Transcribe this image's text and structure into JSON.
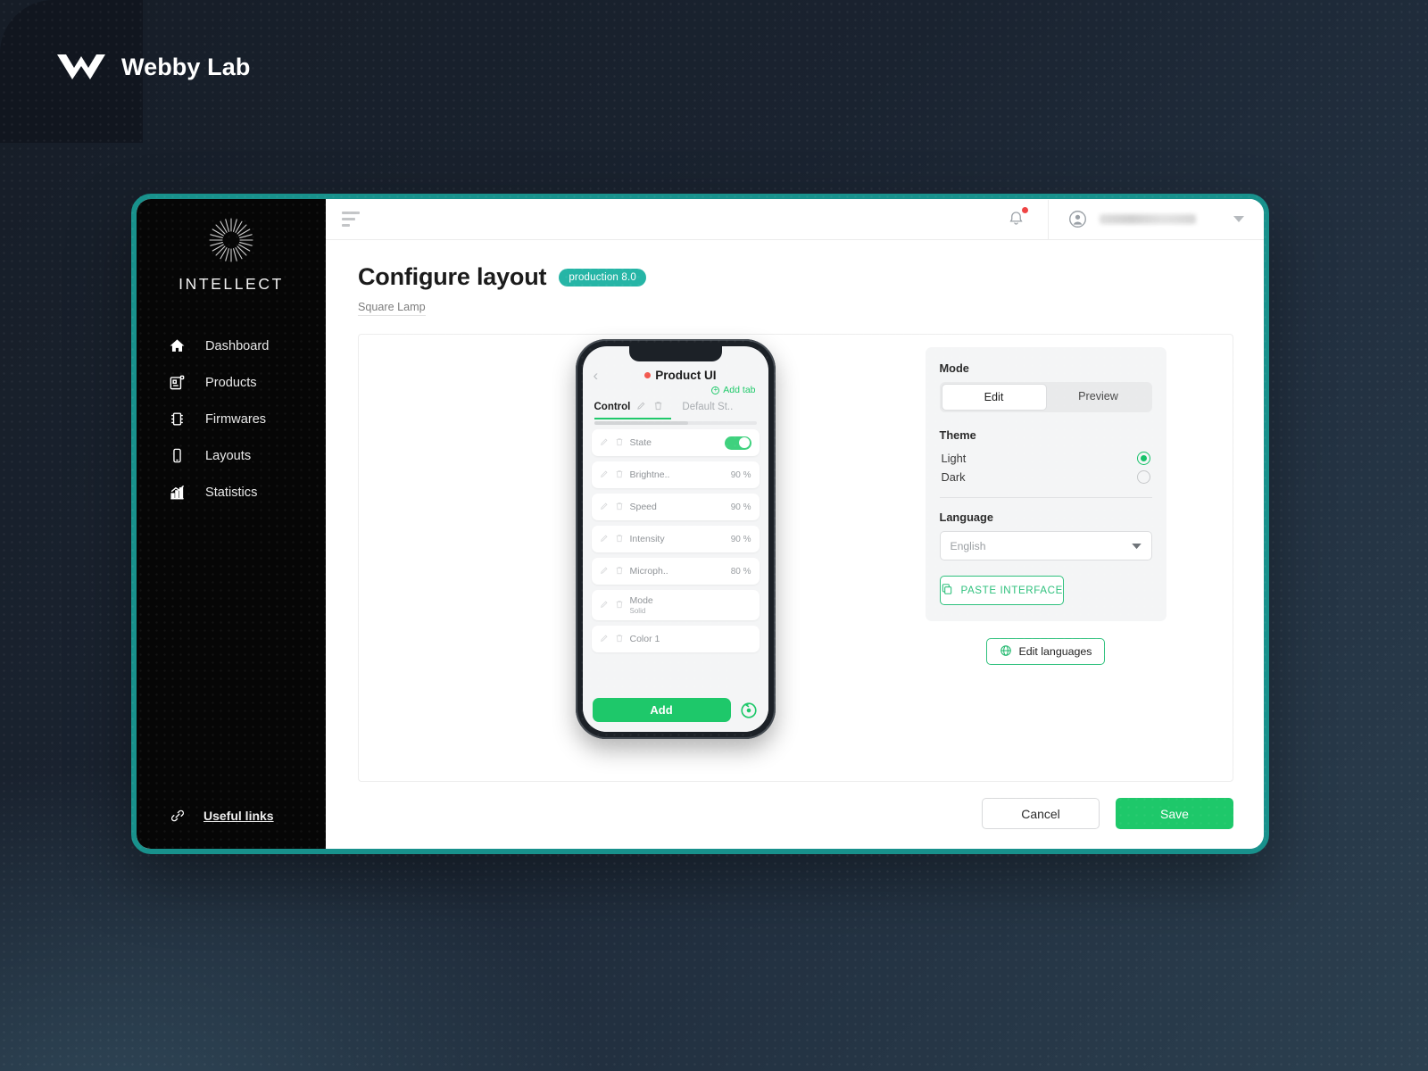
{
  "brand": {
    "name": "Webby Lab",
    "logo_icon": "webbylab-chevron-logo"
  },
  "sidebar": {
    "logo_icon": "starburst-sun-icon",
    "logo_text": "INTELLECT",
    "items": [
      {
        "label": "Dashboard",
        "icon": "home-icon"
      },
      {
        "label": "Products",
        "icon": "products-grid-icon"
      },
      {
        "label": "Firmwares",
        "icon": "chip-icon"
      },
      {
        "label": "Layouts",
        "icon": "mobile-phone-icon"
      },
      {
        "label": "Statistics",
        "icon": "bar-chart-icon"
      }
    ],
    "useful_links": {
      "label": "Useful links",
      "icon": "link-chain-icon"
    }
  },
  "topbar": {
    "menu_icon": "hamburger-menu-icon",
    "bell_icon": "notification-bell-icon",
    "has_notification": true,
    "avatar_icon": "user-avatar-icon",
    "user_name": "",
    "caret_icon": "chevron-down-icon"
  },
  "header": {
    "title": "Configure layout",
    "badge": "production 8.0",
    "breadcrumb": "Square Lamp"
  },
  "phone": {
    "back_icon": "chevron-left-icon",
    "title": "Product UI",
    "status_dot_color": "#f2584e",
    "add_tab": "Add tab",
    "add_tab_icon": "plus-circle-icon",
    "tab_active": "Control",
    "tab_inactive": "Default St..",
    "edit_icon": "pencil-icon",
    "delete_icon": "trash-icon",
    "rows": [
      {
        "label": "State",
        "value": "",
        "sub": "",
        "control": "toggle",
        "toggle_on": true
      },
      {
        "label": "Brightne..",
        "value": "90 %",
        "sub": "",
        "control": "value"
      },
      {
        "label": "Speed",
        "value": "90 %",
        "sub": "",
        "control": "value"
      },
      {
        "label": "Intensity",
        "value": "90 %",
        "sub": "",
        "control": "value"
      },
      {
        "label": "Microph..",
        "value": "80 %",
        "sub": "",
        "control": "value"
      },
      {
        "label": "Mode",
        "value": "",
        "sub": "Solid",
        "control": "value"
      },
      {
        "label": "Color 1",
        "value": "",
        "sub": "",
        "control": "value"
      }
    ],
    "add_button": "Add",
    "reset_icon": "reset-circular-arrow-icon"
  },
  "settings": {
    "mode_label": "Mode",
    "mode_options": [
      "Edit",
      "Preview"
    ],
    "mode_selected": "Edit",
    "theme_label": "Theme",
    "theme_options": [
      "Light",
      "Dark"
    ],
    "theme_selected": "Light",
    "language_label": "Language",
    "language_value": "English",
    "language_caret_icon": "chevron-down-icon",
    "paste_button": "PASTE INTERFACE",
    "paste_icon": "copy-paste-icon",
    "edit_languages_button": "Edit languages",
    "edit_languages_icon": "globe-icon"
  },
  "footer": {
    "cancel": "Cancel",
    "save": "Save"
  },
  "colors": {
    "accent_teal": "#26b5a6",
    "frame_teal": "#18918c",
    "green": "#1ec86a",
    "notify_red": "#ef4444",
    "sidebar_bg": "#060606"
  }
}
